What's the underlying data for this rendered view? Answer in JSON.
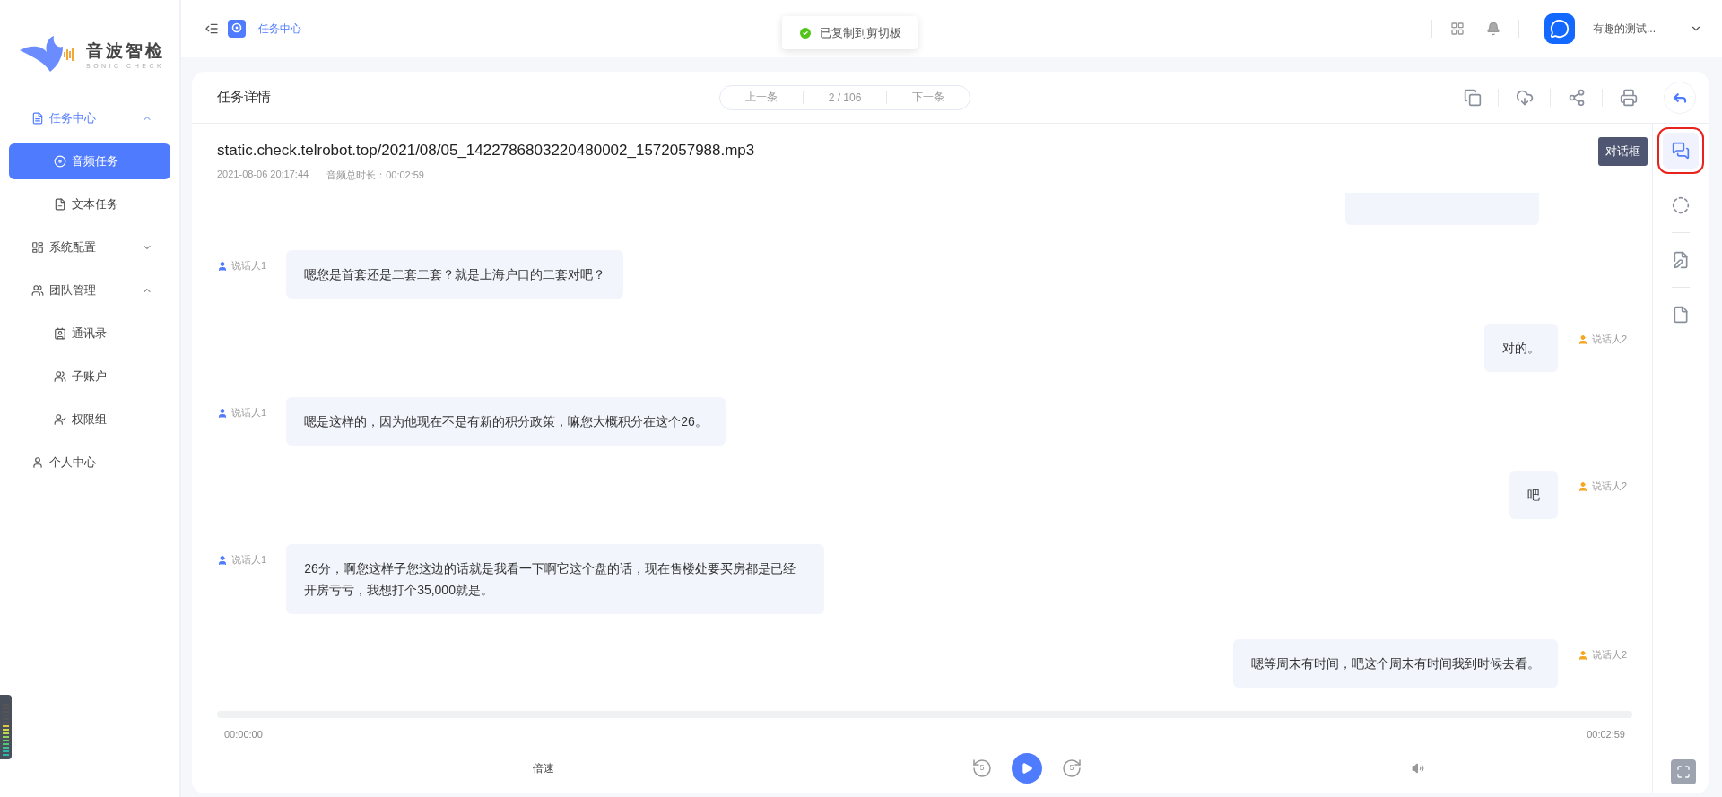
{
  "logo": {
    "name": "音波智检",
    "tagline": "SONIC CHECK"
  },
  "sidebar": {
    "items": [
      {
        "label": "任务中心",
        "expanded": true,
        "selected": false,
        "children": [
          {
            "label": "音频任务",
            "selected": true
          },
          {
            "label": "文本任务",
            "selected": false
          }
        ]
      },
      {
        "label": "系统配置",
        "expanded": false,
        "selected": false
      },
      {
        "label": "团队管理",
        "expanded": true,
        "selected": false,
        "children": [
          {
            "label": "通讯录",
            "selected": false
          },
          {
            "label": "子账户",
            "selected": false
          },
          {
            "label": "权限组",
            "selected": false
          }
        ]
      },
      {
        "label": "个人中心",
        "selected": false
      }
    ]
  },
  "header": {
    "breadcrumb": "任务中心",
    "user": "有趣的测试..."
  },
  "toast": {
    "text": "已复制到剪切板"
  },
  "card": {
    "title": "任务详情",
    "pager": {
      "prev": "上一条",
      "position": "2 / 106",
      "next": "下一条"
    },
    "file": "static.check.telrobot.top/2021/08/05_1422786803220480002_1572057988.mp3",
    "date": "2021-08-06 20:17:44",
    "duration": "音频总时长：00:02:59"
  },
  "rail": {
    "tooltip": "对话框",
    "tools": [
      {
        "kind": "dialog",
        "selected": true
      },
      {
        "kind": "ring",
        "selected": false
      },
      {
        "kind": "edit",
        "selected": false
      },
      {
        "kind": "file",
        "selected": false
      }
    ]
  },
  "messages": [
    {
      "kind": "cut"
    },
    {
      "kind": "left",
      "speaker": "说话人1",
      "text": "嗯您是首套还是二套二套？就是上海户口的二套对吧？"
    },
    {
      "kind": "right",
      "speaker": "说话人2",
      "text": "对的。"
    },
    {
      "kind": "left",
      "speaker": "说话人1",
      "text": "嗯是这样的，因为他现在不是有新的积分政策，嘛您大概积分在这个26。"
    },
    {
      "kind": "right",
      "speaker": "说话人2",
      "text": "吧"
    },
    {
      "kind": "left",
      "speaker": "说话人1",
      "text": "26分，啊您这样子您这边的话就是我看一下啊它这个盘的话，现在售楼处要买房都是已经开房亏亏，我想打个35,000就是。"
    },
    {
      "kind": "right",
      "speaker": "说话人2",
      "text": "嗯等周末有时间，吧这个周末有时间我到时候去看。"
    }
  ],
  "player": {
    "start": "00:00:00",
    "end": "00:02:59",
    "speed": "倍速",
    "skip_back": "5",
    "skip_forward": "5"
  }
}
